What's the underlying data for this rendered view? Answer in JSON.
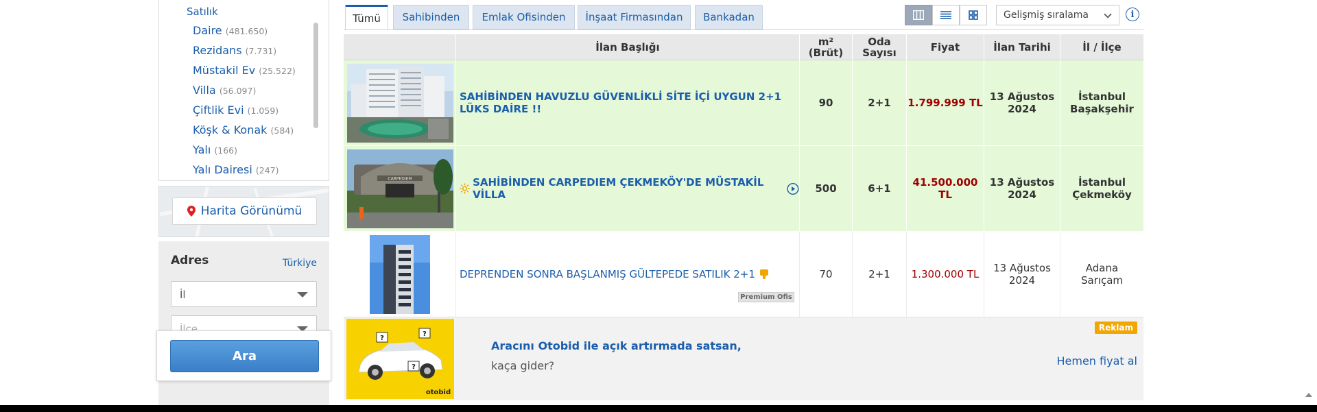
{
  "sidebar": {
    "category_parent": "Satılık",
    "categories": [
      {
        "label": "Daire",
        "count": "(481.650)"
      },
      {
        "label": "Rezidans",
        "count": "(7.731)"
      },
      {
        "label": "Müstakil Ev",
        "count": "(25.522)"
      },
      {
        "label": "Villa",
        "count": "(56.097)"
      },
      {
        "label": "Çiftlik Evi",
        "count": "(1.059)"
      },
      {
        "label": "Köşk & Konak",
        "count": "(584)"
      },
      {
        "label": "Yalı",
        "count": "(166)"
      },
      {
        "label": "Yalı Dairesi",
        "count": "(247)"
      }
    ],
    "map_button": "Harita Görünümü",
    "address": {
      "title": "Adres",
      "country_link": "Türkiye",
      "province_placeholder": "İl",
      "district_placeholder": "İlçe"
    },
    "search_button": "Ara"
  },
  "tabs": [
    {
      "label": "Tümü",
      "active": true
    },
    {
      "label": "Sahibinden",
      "active": false
    },
    {
      "label": "Emlak Ofisinden",
      "active": false
    },
    {
      "label": "İnşaat Firmasından",
      "active": false
    },
    {
      "label": "Bankadan",
      "active": false
    }
  ],
  "toolbar": {
    "view_modes": [
      "table-view-icon",
      "list-view-icon",
      "gallery-view-icon"
    ],
    "active_view": "table-view-icon",
    "sort_label": "Gelişmiş sıralama",
    "info_label": "i"
  },
  "table": {
    "headers": {
      "title": "İlan Başlığı",
      "area": "m² (Brüt)",
      "rooms": "Oda Sayısı",
      "price": "Fiyat",
      "date": "İlan Tarihi",
      "location": "İl / İlçe"
    },
    "rows": [
      {
        "title": "SAHİBİNDEN HAVUZLU GÜVENLİKLİ SİTE İÇİ UYGUN 2+1 LÜKS DAİRE !!",
        "area": "90",
        "rooms": "2+1",
        "price": "1.799.999 TL",
        "date_day": "13 Ağustos",
        "date_year": "2024",
        "city": "İstanbul",
        "district": "Başakşehir",
        "highlighted": true
      },
      {
        "title": "SAHİBİNDEN CARPEDIEM ÇEKMEKÖY'DE MÜSTAKİL VİLLA",
        "area": "500",
        "rooms": "6+1",
        "price": "41.500.000 TL",
        "date_day": "13 Ağustos",
        "date_year": "2024",
        "city": "İstanbul",
        "district": "Çekmeköy",
        "highlighted": true,
        "sign_text": "CARPEDIEM"
      },
      {
        "title": "DEPRENDEN SONRA BAŞLANMIŞ GÜLTEPEDE SATILIK 2+1",
        "area": "70",
        "rooms": "2+1",
        "price": "1.300.000 TL",
        "date_day": "13 Ağustos",
        "date_year": "2024",
        "city": "Adana",
        "district": "Sarıçam",
        "highlighted": false,
        "badge": "Premium Ofis"
      }
    ],
    "ad": {
      "title": "Aracını Otobid ile açık artırmada satsan,",
      "subtitle": "kaça gider?",
      "badge": "Reklam",
      "cta": "Hemen fiyat al",
      "logo_text": "otobid"
    }
  },
  "colors": {
    "link": "#1b5eab",
    "highlight_row": "#e5f8d8",
    "price": "#a00000",
    "ad_badge": "#f2a600",
    "ad_image_bg": "#f7d100"
  }
}
